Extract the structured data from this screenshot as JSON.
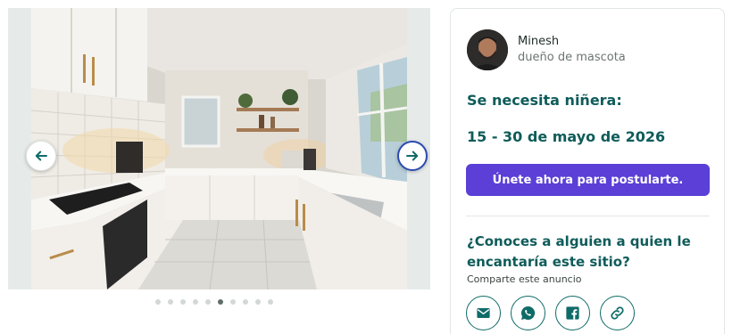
{
  "gallery": {
    "photo_alt": "kitchen-photo",
    "total_images": 10,
    "active_index": 5,
    "prev_icon": "arrow-left-icon",
    "next_icon": "arrow-right-icon"
  },
  "owner": {
    "name": "Minesh",
    "role": "dueño de mascota"
  },
  "listing": {
    "need_title": "Se necesita niñera:",
    "dates": "15 - 30 de mayo de 2026",
    "apply_label": "Únete ahora para postularte."
  },
  "share": {
    "title": "¿Conoces a alguien a quien le encantaría este sitio?",
    "subtitle": "Comparte este anuncio",
    "buttons": [
      {
        "icon": "email-icon"
      },
      {
        "icon": "whatsapp-icon"
      },
      {
        "icon": "facebook-icon"
      },
      {
        "icon": "link-icon"
      }
    ]
  },
  "colors": {
    "brand_teal": "#0f5c5a",
    "button_purple": "#5b3fd6",
    "next_arrow_border": "#2c4bb0"
  }
}
